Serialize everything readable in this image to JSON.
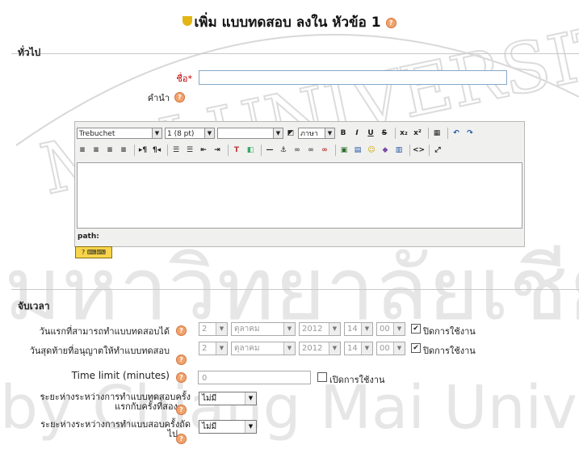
{
  "heading": {
    "title": "เพิ่ม แบบทดสอบ ลงใน หัวข้อ 1"
  },
  "general": {
    "section_title": "ทั่วไป",
    "name_label": "ชื่อ",
    "required_mark": "*",
    "name_value": "",
    "intro_label": "คำนำ"
  },
  "editor": {
    "font_family": "Trebuchet",
    "font_size": "1 (8 pt)",
    "format": "",
    "language": "ภาษา",
    "path_label": "path:",
    "toolbar_row1": [
      "B",
      "I",
      "U",
      "S",
      "x₂",
      "x²",
      "▦",
      "↶",
      "↷"
    ],
    "toolbar_row2": [
      "≡",
      "≡",
      "≡",
      "≡",
      "▸¶",
      "¶◂",
      "☰",
      "☰",
      "⇤",
      "⇥",
      "T",
      "◧",
      "—",
      "⚓",
      "∞",
      "∞",
      "∞",
      "▣",
      "▤",
      "☺",
      "◆",
      "▥",
      "<>",
      "⤢"
    ]
  },
  "timing": {
    "section_title": "จับเวลา",
    "open_label": "วันแรกที่สามารถทำแบบทดสอบได้",
    "close_label": "วันสุดท้ายที่อนุญาตให้ทำแบบทดสอบ",
    "open": {
      "day": "2",
      "month": "ตุลาคม",
      "year": "2012",
      "hour": "14",
      "minute": "00",
      "disabled_label": "ปิดการใช้งาน",
      "disabled_checked": true
    },
    "close": {
      "day": "2",
      "month": "ตุลาคม",
      "year": "2012",
      "hour": "14",
      "minute": "00",
      "disabled_label": "ปิดการใช้งาน",
      "disabled_checked": true
    },
    "time_limit_label": "Time limit (minutes)",
    "time_limit_value": "0",
    "time_limit_enable_label": "เปิดการใช้งาน",
    "time_limit_enabled": false,
    "delay1_label_line1": "ระยะห่างระหว่างการทำแบบทดสอบครั้ง",
    "delay1_label_line2": "แรกกับครั้งที่สอง",
    "delay1_value": "ไม่มี",
    "delay2_label_line1": "ระยะห่างระหว่างการทำแบบสอบครั้งถัด",
    "delay2_label_line2": "ไป",
    "delay2_value": "ไม่มี"
  },
  "watermark": {
    "line1": "MAI UNIVERSITY",
    "line2": "มหาวิทยาลัยเชียงใหม่",
    "line3": "by Chiang Mai University"
  }
}
